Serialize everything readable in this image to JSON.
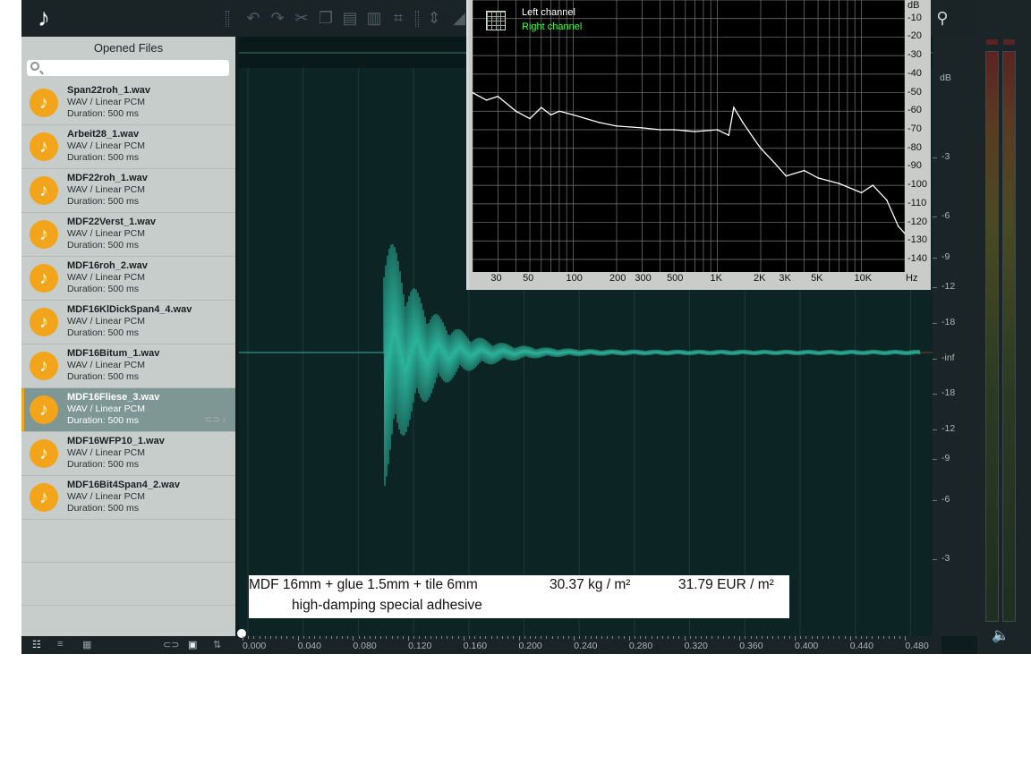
{
  "toolbar": {
    "logo_icon": "music-note-icon",
    "buttons": [
      "undo-icon",
      "redo-icon",
      "cut-icon",
      "copy-icon",
      "paste-icon",
      "delete-icon",
      "crop-icon",
      "normalize-icon"
    ],
    "right_icon": "tuning-fork-icon"
  },
  "left_panel": {
    "title": "Opened Files",
    "search_placeholder": "",
    "files": [
      {
        "name": "Span22roh_1.wav",
        "type": "WAV / Linear PCM",
        "duration": "Duration: 500 ms",
        "selected": false
      },
      {
        "name": "Arbeit28_1.wav",
        "type": "WAV / Linear PCM",
        "duration": "Duration: 500 ms",
        "selected": false
      },
      {
        "name": "MDF22roh_1.wav",
        "type": "WAV / Linear PCM",
        "duration": "Duration: 500 ms",
        "selected": false
      },
      {
        "name": "MDF22Verst_1.wav",
        "type": "WAV / Linear PCM",
        "duration": "Duration: 500 ms",
        "selected": false
      },
      {
        "name": "MDF16roh_2.wav",
        "type": "WAV / Linear PCM",
        "duration": "Duration: 500 ms",
        "selected": false
      },
      {
        "name": "MDF16KlDickSpan4_4.wav",
        "type": "WAV / Linear PCM",
        "duration": "Duration: 500 ms",
        "selected": false
      },
      {
        "name": "MDF16Bitum_1.wav",
        "type": "WAV / Linear PCM",
        "duration": "Duration: 500 ms",
        "selected": false
      },
      {
        "name": "MDF16Fliese_3.wav",
        "type": "WAV / Linear PCM",
        "duration": "Duration: 500 ms",
        "selected": true
      },
      {
        "name": "MDF16WFP10_1.wav",
        "type": "WAV / Linear PCM",
        "duration": "Duration: 500 ms",
        "selected": false
      },
      {
        "name": "MDF16Bit4Span4_2.wav",
        "type": "WAV / Linear PCM",
        "duration": "Duration: 500 ms",
        "selected": false
      }
    ]
  },
  "scale": {
    "unit": "dB",
    "labels": [
      "-3",
      "-6",
      "-9",
      "-12",
      "-18",
      "-inf",
      "-18",
      "-12",
      "-9",
      "-6",
      "-3"
    ]
  },
  "ruler": {
    "labels": [
      "0.000",
      "0.040",
      "0.080",
      "0.120",
      "0.160",
      "0.200",
      "0.240",
      "0.280",
      "0.320",
      "0.360",
      "0.400",
      "0.440",
      "0.480"
    ]
  },
  "spectrum": {
    "legend_left": "Left channel",
    "legend_right": "Right channel",
    "legend_left_color": "#ffffff",
    "legend_right_color": "#44ff44",
    "x_unit": "Hz",
    "y_unit": "dB",
    "x_labels": [
      "30",
      "50",
      "100",
      "200",
      "300",
      "500",
      "1K",
      "2K",
      "3K",
      "5K",
      "10K"
    ],
    "y_labels": [
      "-10",
      "-20",
      "-30",
      "-40",
      "-50",
      "-60",
      "-70",
      "-80",
      "-90",
      "-100",
      "-110",
      "-120",
      "-130",
      "-140"
    ]
  },
  "caption": {
    "line1_a": "MDF 16mm + glue 1.5mm + tile 6mm",
    "line1_b": "30.37 kg / m²",
    "line1_c": "31.79 EUR / m²",
    "line2": "high-damping special adhesive"
  },
  "colors": {
    "accent": "#f2a51a",
    "waveform": "#2bb39a",
    "background": "#0d2020"
  },
  "chart_data": {
    "type": "line",
    "title": "",
    "xlabel": "Hz",
    "ylabel": "dB",
    "x_scale": "log",
    "xlim": [
      20,
      20000
    ],
    "ylim": [
      -140,
      0
    ],
    "series": [
      {
        "name": "Left channel",
        "x": [
          20,
          25,
          30,
          40,
          50,
          60,
          70,
          80,
          100,
          150,
          200,
          300,
          400,
          500,
          700,
          1000,
          1200,
          1300,
          1500,
          1800,
          2000,
          2500,
          3000,
          4000,
          5000,
          7000,
          10000,
          12000,
          15000,
          18000,
          20000
        ],
        "y": [
          -50,
          -54,
          -52,
          -60,
          -64,
          -58,
          -62,
          -60,
          -62,
          -66,
          -68,
          -69,
          -70,
          -70,
          -71,
          -70,
          -73,
          -58,
          -66,
          -75,
          -80,
          -88,
          -95,
          -92,
          -96,
          -99,
          -104,
          -100,
          -108,
          -122,
          -126
        ]
      }
    ]
  }
}
